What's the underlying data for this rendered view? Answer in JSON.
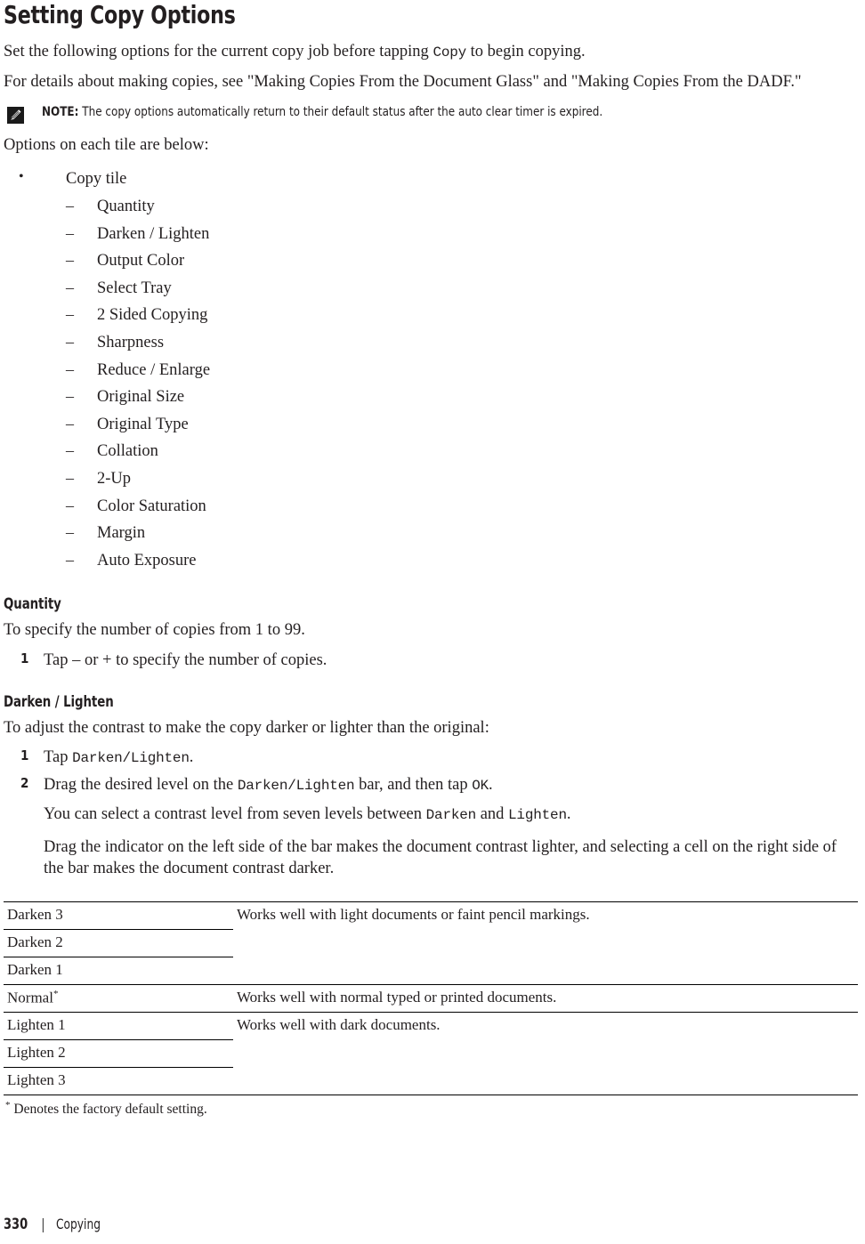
{
  "page": {
    "title": "Setting Copy Options",
    "footer": {
      "page_number": "330",
      "separator": "|",
      "chapter": "Copying"
    }
  },
  "intro": {
    "para1_before": "Set the following options for the current copy job before tapping ",
    "para1_code": "Copy",
    "para1_after": " to begin copying.",
    "para2": "For details about making copies, see \"Making Copies From the Document Glass\" and \"Making Copies From the DADF.\""
  },
  "note": {
    "icon": "note-pencil-icon",
    "label": "NOTE:",
    "text": "The copy options automatically return to their default status after the auto clear timer is expired."
  },
  "options_intro": "Options on each tile are below:",
  "options_list": {
    "bullet_marker": "•",
    "dash_marker": "–",
    "group_label": "Copy tile",
    "items": [
      "Quantity",
      "Darken / Lighten",
      "Output Color",
      "Select Tray",
      "2 Sided Copying",
      "Sharpness",
      "Reduce / Enlarge",
      "Original Size",
      "Original Type",
      "Collation",
      "2-Up",
      "Color Saturation",
      "Margin",
      "Auto Exposure"
    ]
  },
  "quantity": {
    "heading": "Quantity",
    "intro": "To specify the number of copies from 1 to 99.",
    "step1_num": "1",
    "step1_text": "Tap – or + to specify the number of copies."
  },
  "darken_lighten": {
    "heading": "Darken / Lighten",
    "intro": "To adjust the contrast to make the copy darker or lighter than the original:",
    "step1_num": "1",
    "step1_before": "Tap ",
    "step1_code": "Darken/Lighten",
    "step1_after": ".",
    "step2_num": "2",
    "step2_before": "Drag the desired level on the ",
    "step2_code1": "Darken/Lighten",
    "step2_mid": " bar, and then tap ",
    "step2_code2": "OK",
    "step2_after": ".",
    "sub1_before": "You can select a contrast level from seven levels between ",
    "sub1_code1": "Darken",
    "sub1_mid": " and ",
    "sub1_code2": "Lighten",
    "sub1_after": ".",
    "sub2": "Drag the indicator on the left side of the bar makes the document contrast lighter, and selecting a cell on the right side of the bar makes the document contrast darker."
  },
  "table": {
    "rows": [
      {
        "level": "Darken 3",
        "description": "Works well with light documents or faint pencil markings.",
        "divider": "full",
        "has_desc": true
      },
      {
        "level": "Darken 2",
        "description": "",
        "divider": "half",
        "has_desc": false
      },
      {
        "level": "Darken 1",
        "description": "",
        "divider": "half",
        "has_desc": false
      },
      {
        "level": "Normal",
        "suffix": "*",
        "description": "Works well with normal typed or printed documents.",
        "divider": "full",
        "has_desc": true
      },
      {
        "level": "Lighten 1",
        "description": "Works well with dark documents.",
        "divider": "full",
        "has_desc": true
      },
      {
        "level": "Lighten 2",
        "description": "",
        "divider": "half",
        "has_desc": false
      },
      {
        "level": "Lighten 3",
        "description": "",
        "divider": "half",
        "has_desc": false
      }
    ],
    "footnote_marker": "*",
    "footnote_text": " Denotes the factory default setting."
  }
}
